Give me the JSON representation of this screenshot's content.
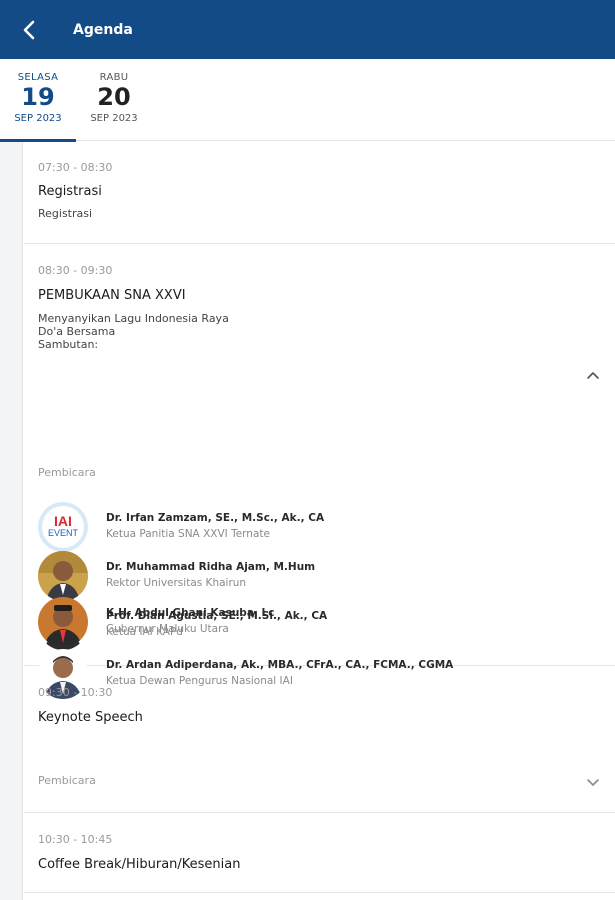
{
  "header": {
    "title": "Agenda",
    "back_icon": "chevron-left-icon"
  },
  "day_tabs": [
    {
      "dayname": "SELASA",
      "day": "19",
      "month": "SEP 2023",
      "active": true
    },
    {
      "dayname": "RABU",
      "day": "20",
      "month": "SEP 2023",
      "active": false
    }
  ],
  "sessions": [
    {
      "time": "07:30 - 08:30",
      "title": "Registrasi",
      "description": [
        "Registrasi"
      ]
    },
    {
      "time": "08:30 - 09:30",
      "title": "PEMBUKAAN SNA XXVI",
      "description": [
        "Menyanyikan Lagu Indonesia Raya",
        "Do'a Bersama",
        "Sambutan:"
      ],
      "speakers_label": "Pembicara",
      "expanded": true,
      "speakers": [
        {
          "name": "Dr. Irfan Zamzam, SE., M.Sc., Ak., CA",
          "role": "Ketua Panitia SNA XXVI Ternate",
          "logo_line1": "IAI",
          "logo_line2": "EVENT"
        },
        {
          "name": "Dr. Muhammad Ridha Ajam, M.Hum",
          "role": "Rektor Universitas Khairun"
        },
        {
          "name": "Prof. Dian Agustia, SE., M.Si., Ak., CA",
          "role": "Ketua IAI KAPd"
        },
        {
          "name": "Dr. Ardan Adiperdana, Ak., MBA., CFrA., CA., FCMA., CGMA",
          "role": "Ketua Dewan Pengurus Nasional IAI"
        },
        {
          "name": "K.H. Abdul Ghani Kasuba, Lc",
          "role": "Gubernur Maluku Utara"
        }
      ]
    },
    {
      "time": "09:30 - 10:30",
      "title": "Keynote Speech",
      "speakers_label": "Pembicara",
      "expanded": false
    },
    {
      "time": "10:30 - 10:45",
      "title": "Coffee Break/Hiburan/Kesenian"
    }
  ],
  "colors": {
    "primary": "#134b87",
    "rail": "#f3f4f6",
    "muted": "#9a9a9a"
  }
}
